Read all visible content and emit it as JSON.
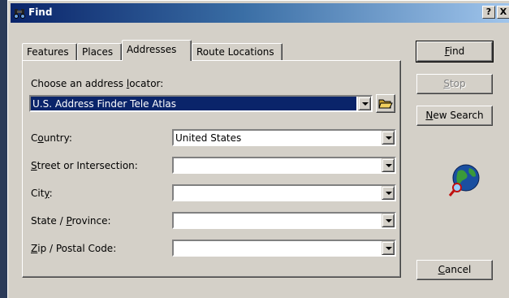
{
  "window": {
    "title": "Find",
    "help_label": "?",
    "close_label": "X"
  },
  "tabs": [
    {
      "label": "Features"
    },
    {
      "label": "Places"
    },
    {
      "label": "Addresses"
    },
    {
      "label": "Route Locations"
    }
  ],
  "locator": {
    "label_pre": "Choose an address ",
    "label_u": "l",
    "label_post": "ocator:",
    "value": "U.S. Address Finder Tele Atlas"
  },
  "fields": {
    "country": {
      "pre": "C",
      "u": "o",
      "post": "untry:",
      "value": "United States"
    },
    "street": {
      "pre": "",
      "u": "S",
      "post": "treet or Intersection:",
      "value": ""
    },
    "city": {
      "pre": "Cit",
      "u": "y",
      "post": ":",
      "value": ""
    },
    "state": {
      "pre": "State / ",
      "u": "P",
      "post": "rovince:",
      "value": ""
    },
    "zip": {
      "pre": "",
      "u": "Z",
      "post": "ip / Postal Code:",
      "value": ""
    }
  },
  "buttons": {
    "find": {
      "u": "F",
      "rest": "ind"
    },
    "stop": {
      "u": "S",
      "rest": "top"
    },
    "new_search": {
      "u": "N",
      "rest": "ew Search"
    },
    "cancel": {
      "u": "C",
      "rest": "ancel"
    }
  },
  "icons": {
    "title": "binoculars-icon",
    "browse": "open-folder-icon",
    "globe": "globe-magnifier-icon"
  }
}
